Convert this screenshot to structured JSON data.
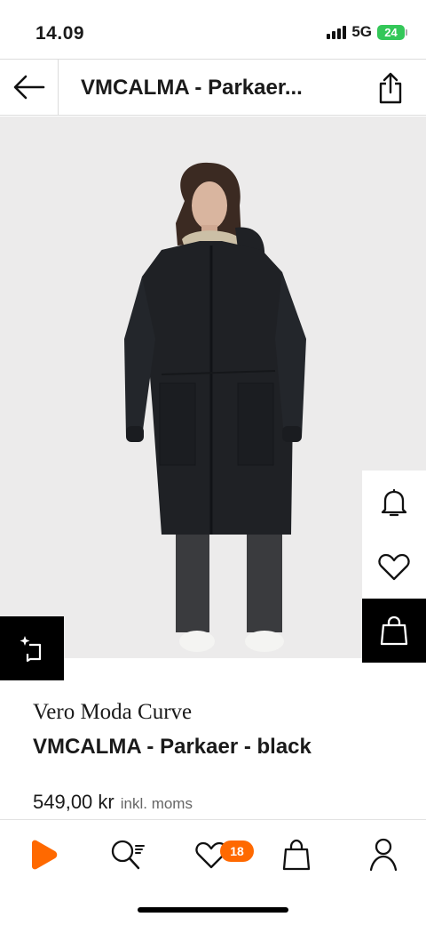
{
  "status_bar": {
    "time": "14.09",
    "network": "5G",
    "battery": "24"
  },
  "header": {
    "title": "VMCALMA - Parkaer...",
    "back_icon": "arrow-left-icon",
    "share_icon": "share-icon"
  },
  "actions": {
    "notify_icon": "bell-icon",
    "wishlist_icon": "heart-icon",
    "bag_icon": "shopping-bag-icon",
    "crop_icon": "sparkle-crop-icon"
  },
  "product": {
    "brand": "Vero Moda Curve",
    "name": "VMCALMA - Parkaer - black",
    "price": "549,00 kr",
    "vat": "inkl. moms"
  },
  "bottom_nav": {
    "items": [
      {
        "icon": "home-icon"
      },
      {
        "icon": "search-icon"
      },
      {
        "icon": "heart-icon",
        "badge": "18"
      },
      {
        "icon": "bag-icon"
      },
      {
        "icon": "account-icon"
      }
    ]
  },
  "colors": {
    "accent": "#ff6900",
    "battery": "#34c759",
    "image_bg": "#ecebeb"
  }
}
